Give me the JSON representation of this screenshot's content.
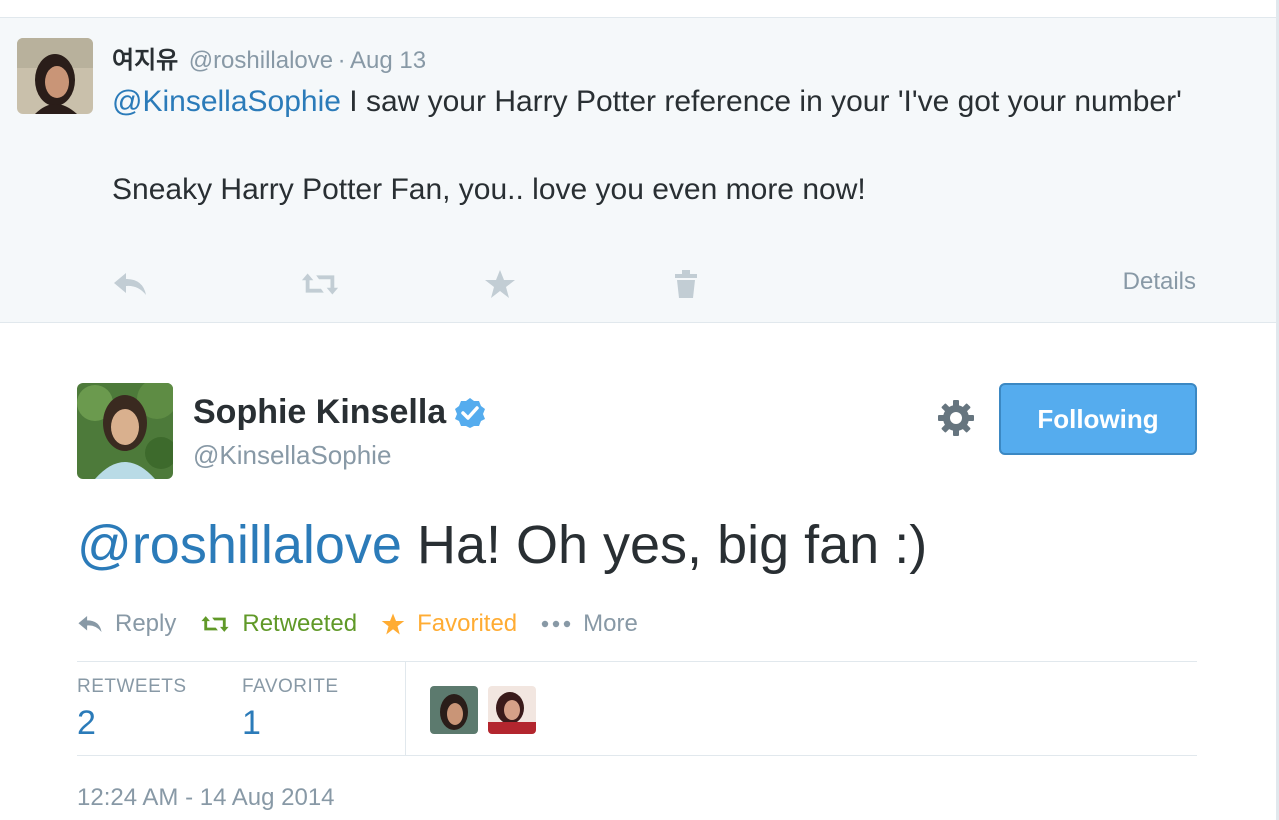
{
  "parent_tweet": {
    "author_name": "여지유",
    "author_handle": "@roshillalove",
    "separator": "·",
    "date": "Aug 13",
    "text_mention": "@KinsellaSophie",
    "text_line1": " I saw your Harry Potter reference in your 'I've got your number'",
    "text_line2": "Sneaky Harry Potter Fan, you.. love you even more now!",
    "details_label": "Details",
    "icons": [
      "reply-icon",
      "retweet-icon",
      "favorite-icon",
      "delete-icon"
    ]
  },
  "main_tweet": {
    "author_name": "Sophie Kinsella",
    "author_handle": "@KinsellaSophie",
    "follow_button_label": "Following",
    "text_mention": "@roshillalove",
    "text_body": " Ha! Oh yes, big fan :)",
    "actions": {
      "reply_label": "Reply",
      "retweet_label": "Retweeted",
      "favorite_label": "Favorited",
      "more_label": "More"
    },
    "stats": {
      "retweets_label": "RETWEETS",
      "retweets_count": "2",
      "favorites_label": "FAVORITE",
      "favorites_count": "1"
    },
    "timestamp": "12:24 AM - 14 Aug 2014"
  },
  "colors": {
    "link": "#2b7bb9",
    "muted": "#8899a6",
    "retweeted": "#609928",
    "favorited": "#ffac33",
    "follow_button": "#55acee",
    "parent_background": "#f5f8fa"
  }
}
